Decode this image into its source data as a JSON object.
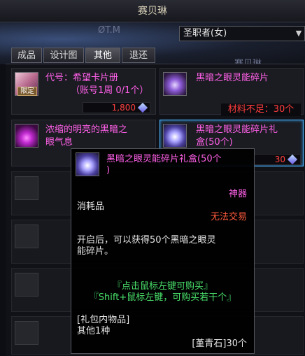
{
  "window": {
    "title": "赛贝琳"
  },
  "banner": {
    "text1": "ØT.M",
    "text2": "赛贝琳"
  },
  "job_select": {
    "value": "圣职者(女)"
  },
  "tabs": [
    {
      "label": "成品",
      "active": false
    },
    {
      "label": "设计图",
      "active": false
    },
    {
      "label": "其他",
      "active": true
    },
    {
      "label": "退还",
      "active": false
    }
  ],
  "items": [
    {
      "name_line1": "代号：希望卡片册",
      "name_line2": "（账号1周 0/1个）",
      "badge": "限定",
      "price": "1,800",
      "icon": "card-album-icon"
    },
    {
      "name_line1": "黑暗之眼灵能碎片",
      "warning": "材料不足：30个",
      "icon": "dark-crystal-icon"
    },
    {
      "name_line1": "浓缩的明亮的黑暗之",
      "name_line2": "眼气息",
      "icon": "dark-aura-icon"
    },
    {
      "name_line1": "黑暗之眼灵能碎片礼",
      "name_line2": "盒(50个)",
      "price": "30",
      "icon": "crystal-gift-box-icon"
    }
  ],
  "tooltip": {
    "title_line1": "黑暗之眼灵能碎片礼盒(50个",
    "title_line2": ")",
    "grade": "神器",
    "type": "消耗品",
    "trade": "无法交易",
    "desc_line1": "开启后，可以获得50个黑暗之眼灵",
    "desc_line2": "能碎片。",
    "hint1": "『点击鼠标左键可购买』",
    "hint2": "『Shift+鼠标左键，可购买若干个』",
    "contents_label": "[礼包内物品]",
    "contents_value": "其他1种",
    "cost": "[堇青石]30个"
  },
  "colors": {
    "item_name": "#ff60e8",
    "price": "#ff4040",
    "hint": "#49e06a",
    "grade": "#ff60e8",
    "trade": "#ff5a3c"
  }
}
